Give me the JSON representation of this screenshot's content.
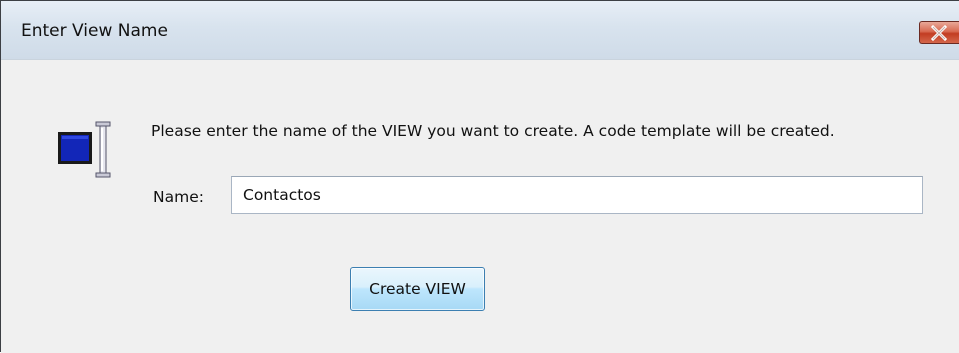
{
  "dialog": {
    "title": "Enter View Name",
    "close_icon": "close-x-icon",
    "message": "Please enter the name of the VIEW you want to create. A code template will be created.",
    "name_label": "Name:",
    "name_value": "Contactos",
    "create_button_label": "Create VIEW",
    "view_icon": "view-monitor-icon"
  },
  "colors": {
    "close_button": "#c23c22",
    "icon_screen": "#1226b8",
    "button_border": "#3c7fb1"
  }
}
